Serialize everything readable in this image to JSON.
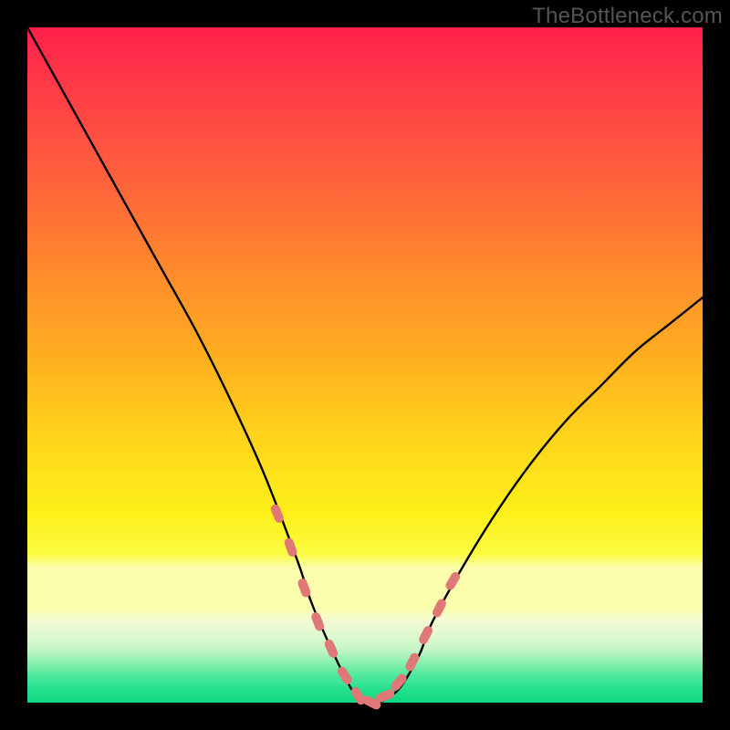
{
  "watermark": "TheBottleneck.com",
  "colors": {
    "frame": "#000000",
    "curve": "#000000",
    "marker": "#e07878",
    "gradient_top": "#ff1f4a",
    "gradient_mid": "#fdf019",
    "gradient_band": "#fbfdac",
    "gradient_bottom": "#0fd884"
  },
  "chart_data": {
    "type": "line",
    "title": "",
    "xlabel": "",
    "ylabel": "",
    "xlim": [
      0,
      100
    ],
    "ylim": [
      0,
      100
    ],
    "series": [
      {
        "name": "curve",
        "x": [
          0,
          5,
          10,
          15,
          20,
          25,
          30,
          35,
          40,
          42,
          45,
          48,
          50,
          52,
          55,
          58,
          60,
          65,
          70,
          75,
          80,
          85,
          90,
          95,
          100
        ],
        "values": [
          100,
          91,
          82,
          73,
          64,
          55,
          45,
          34,
          21,
          15,
          8,
          2,
          0,
          0,
          2,
          7,
          12,
          21,
          29,
          36,
          42,
          47,
          52,
          56,
          60
        ]
      }
    ],
    "markers": {
      "name": "highlight-points",
      "x": [
        37,
        39,
        41,
        43,
        45,
        47,
        49,
        51,
        53,
        55,
        57,
        59,
        61,
        63
      ],
      "values": [
        28,
        23,
        17,
        12,
        8,
        4,
        1,
        0,
        1,
        3,
        6,
        10,
        14,
        18
      ]
    }
  }
}
